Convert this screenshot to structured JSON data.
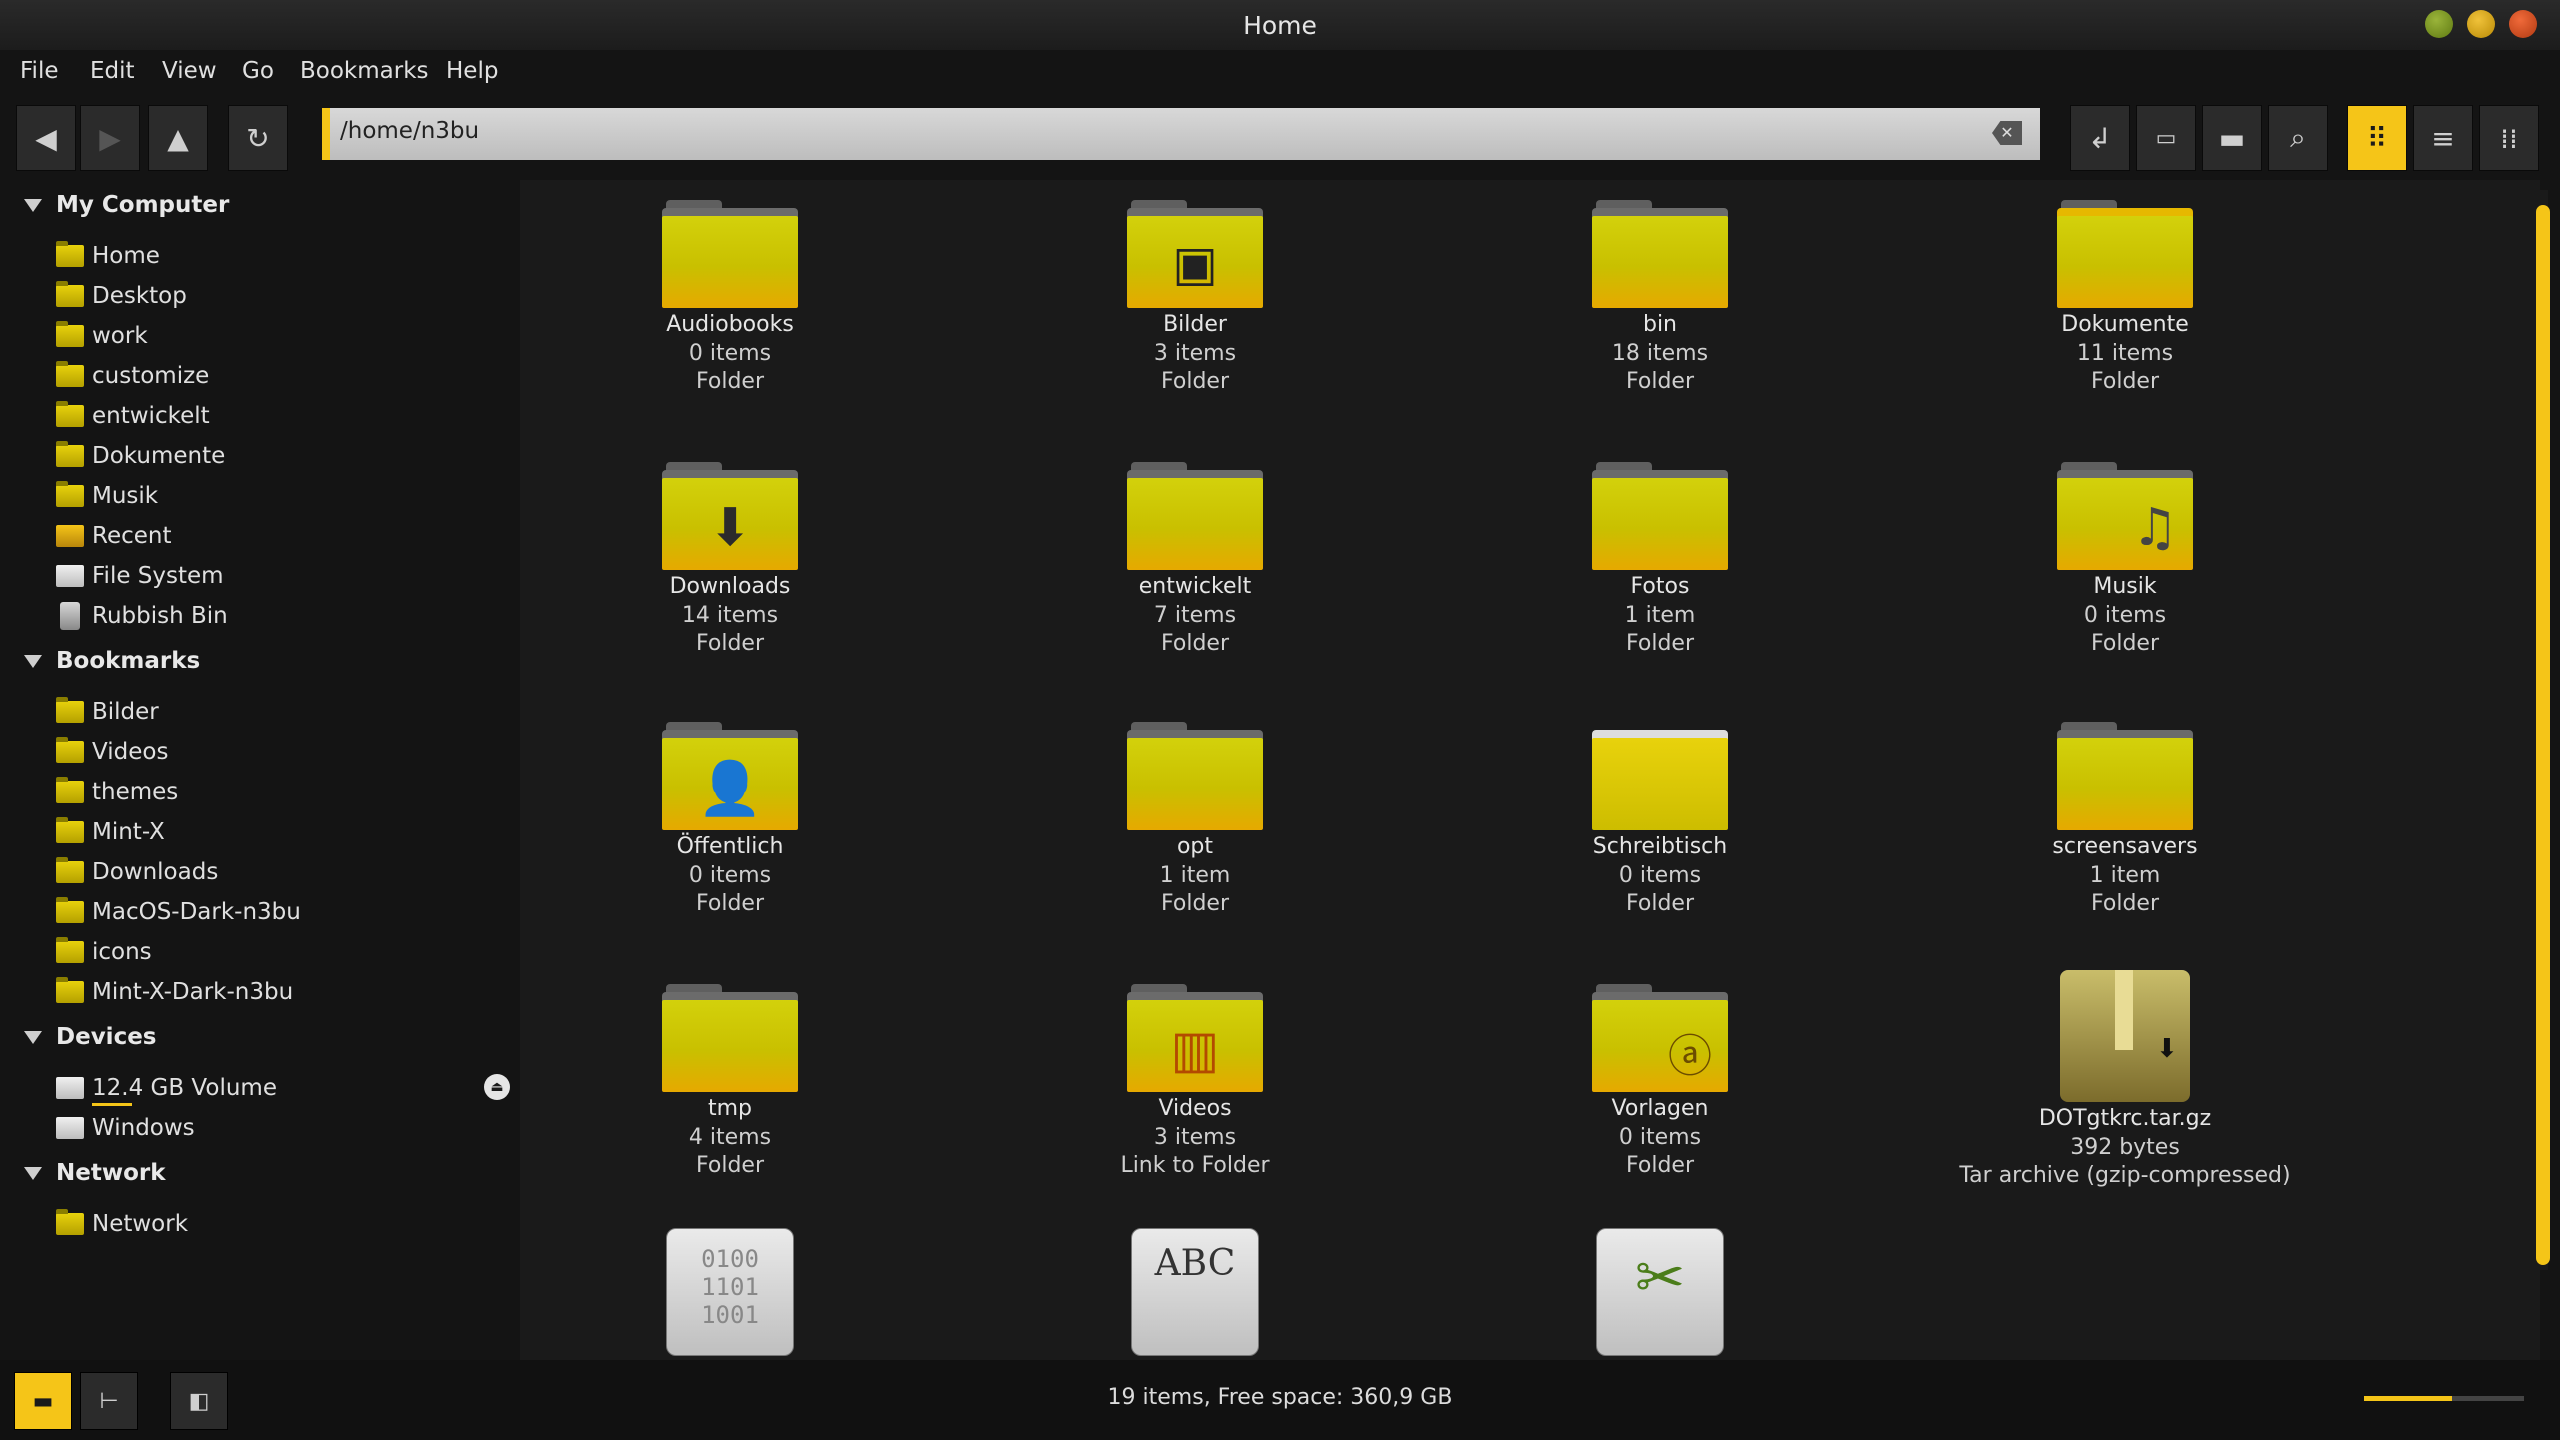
{
  "window": {
    "title": "Home"
  },
  "menu": [
    "File",
    "Edit",
    "View",
    "Go",
    "Bookmarks",
    "Help"
  ],
  "address": {
    "path": "/home/n3bu"
  },
  "toolbar": {
    "nav_icons": [
      "back-icon",
      "forward-icon",
      "up-icon",
      "reload-icon"
    ],
    "right_icons": [
      "open-location-icon",
      "terminal-icon",
      "new-folder-icon",
      "search-icon"
    ],
    "view_icons": [
      "icon-view-icon",
      "list-view-icon",
      "compact-view-icon"
    ],
    "active_view": "icon-view"
  },
  "sidebar": {
    "my_computer": {
      "label": "My Computer",
      "items": [
        "Home",
        "Desktop",
        "work",
        "customize",
        "entwickelt",
        "Dokumente",
        "Musik",
        "Recent",
        "File System",
        "Rubbish Bin"
      ]
    },
    "bookmarks": {
      "label": "Bookmarks",
      "items": [
        "Bilder",
        "Videos",
        "themes",
        "Mint-X",
        "Downloads",
        "MacOS-Dark-n3bu",
        "icons",
        "Mint-X-Dark-n3bu"
      ]
    },
    "devices": {
      "label": "Devices",
      "items": [
        "12.4 GB Volume",
        "Windows"
      ]
    },
    "network": {
      "label": "Network",
      "items": [
        "Network"
      ]
    }
  },
  "files": [
    {
      "name": "Audiobooks",
      "count": "0 items",
      "type": "Folder"
    },
    {
      "name": "Bilder",
      "count": "3 items",
      "type": "Folder"
    },
    {
      "name": "bin",
      "count": "18 items",
      "type": "Folder"
    },
    {
      "name": "Dokumente",
      "count": "11 items",
      "type": "Folder"
    },
    {
      "name": "Downloads",
      "count": "14 items",
      "type": "Folder"
    },
    {
      "name": "entwickelt",
      "count": "7 items",
      "type": "Folder"
    },
    {
      "name": "Fotos",
      "count": "1 item",
      "type": "Folder"
    },
    {
      "name": "Musik",
      "count": "0 items",
      "type": "Folder"
    },
    {
      "name": "Öffentlich",
      "count": "0 items",
      "type": "Folder"
    },
    {
      "name": "opt",
      "count": "1 item",
      "type": "Folder"
    },
    {
      "name": "Schreibtisch",
      "count": "0 items",
      "type": "Folder"
    },
    {
      "name": "screensavers",
      "count": "1 item",
      "type": "Folder"
    },
    {
      "name": "tmp",
      "count": "4 items",
      "type": "Folder"
    },
    {
      "name": "Videos",
      "count": "3 items",
      "type": "Link to Folder"
    },
    {
      "name": "Vorlagen",
      "count": "0 items",
      "type": "Folder"
    },
    {
      "name": "DOTgtkrc.tar.gz",
      "count": "392 bytes",
      "type": "Tar archive (gzip-compressed)"
    }
  ],
  "partial_icons": {
    "binary": "0100\n1101\n1001",
    "text": "ABC"
  },
  "status": {
    "text": "19 items, Free space: 360,9 GB",
    "zoom_fraction": 0.55
  },
  "colors": {
    "accent": "#f5c518",
    "background": "#1a1a1a",
    "sidebar": "#141414"
  }
}
